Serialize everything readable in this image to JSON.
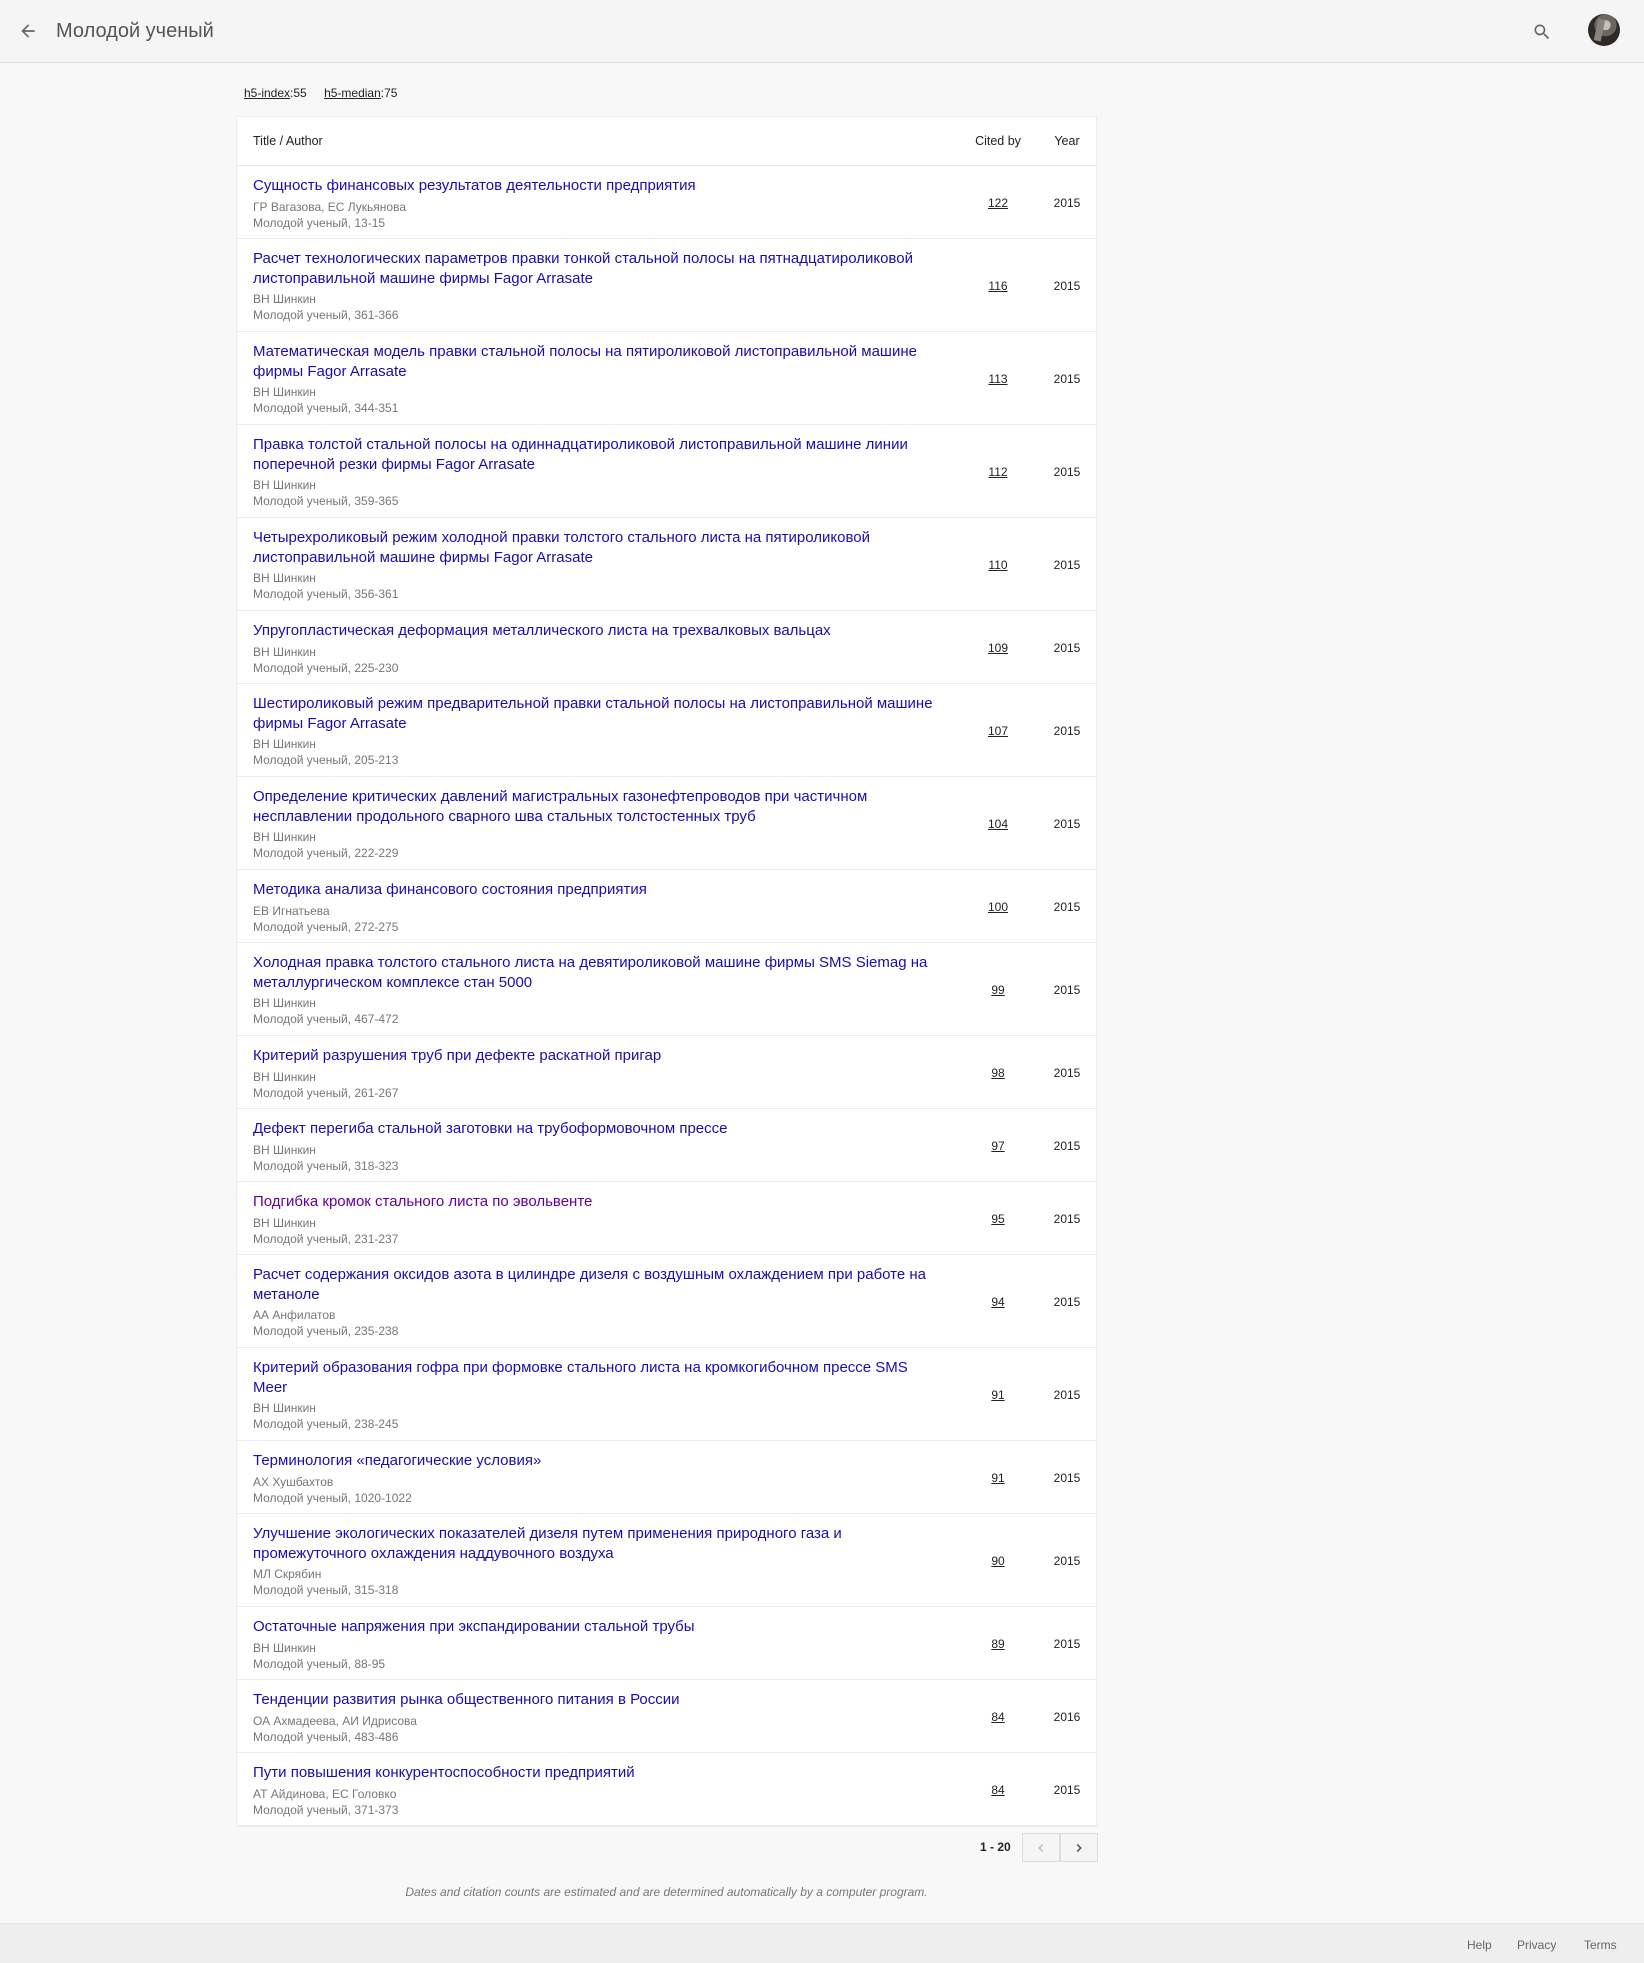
{
  "header": {
    "back_icon": "arrow-back-icon",
    "title": "Молодой ученый",
    "search_icon": "search-icon"
  },
  "metrics": {
    "h5_index_label": "h5-index",
    "h5_index_value": ":55",
    "h5_median_label": "h5-median",
    "h5_median_value": ":75"
  },
  "table": {
    "col_title": "Title / Author",
    "col_cited": "Cited by",
    "col_year": "Year",
    "rows": [
      {
        "title": "Сущность финансовых результатов деятельности предприятия",
        "authors": "ГР Вагазова, ЕС Лукьянова",
        "venue": "Молодой ученый, 13-15",
        "cited": "122",
        "year": "2015"
      },
      {
        "title": "Расчет технологических параметров правки тонкой стальной полосы на пятнадцатироликовой листоправильной машине фирмы Fagor Arrasate",
        "authors": "ВН Шинкин",
        "venue": "Молодой ученый, 361-366",
        "cited": "116",
        "year": "2015"
      },
      {
        "title": "Математическая модель правки стальной полосы на пятироликовой листоправильной машине фирмы Fagor Arrasate",
        "authors": "ВН Шинкин",
        "venue": "Молодой ученый, 344-351",
        "cited": "113",
        "year": "2015"
      },
      {
        "title": "Правка толстой стальной полосы на одиннадцатироликовой листоправильной машине линии поперечной резки фирмы Fagor Arrasate",
        "authors": "ВН Шинкин",
        "venue": "Молодой ученый, 359-365",
        "cited": "112",
        "year": "2015"
      },
      {
        "title": "Четырехроликовый режим холодной правки толстого стального листа на пятироликовой листоправильной машине фирмы Fagor Arrasate",
        "authors": "ВН Шинкин",
        "venue": "Молодой ученый, 356-361",
        "cited": "110",
        "year": "2015"
      },
      {
        "title": "Упругопластическая деформация металлического листа на трехвалковых вальцах",
        "authors": "ВН Шинкин",
        "venue": "Молодой ученый, 225-230",
        "cited": "109",
        "year": "2015"
      },
      {
        "title": "Шестироликовый режим предварительной правки стальной полосы на листоправильной машине фирмы Fagor Arrasate",
        "authors": "ВН Шинкин",
        "venue": "Молодой ученый, 205-213",
        "cited": "107",
        "year": "2015"
      },
      {
        "title": "Определение критических давлений магистральных газонефтепроводов при частичном несплавлении продольного сварного шва стальных толстостенных труб",
        "authors": "ВН Шинкин",
        "venue": "Молодой ученый, 222-229",
        "cited": "104",
        "year": "2015"
      },
      {
        "title": "Методика анализа финансового состояния предприятия",
        "authors": "ЕВ Игнатьева",
        "venue": "Молодой ученый, 272-275",
        "cited": "100",
        "year": "2015"
      },
      {
        "title": "Холодная правка толстого стального листа на девятироликовой машине фирмы SMS Siemag на металлургическом комплексе стан 5000",
        "authors": "ВН Шинкин",
        "venue": "Молодой ученый, 467-472",
        "cited": "99",
        "year": "2015"
      },
      {
        "title": "Критерий разрушения труб при дефекте раскатной пригар",
        "authors": "ВН Шинкин",
        "venue": "Молодой ученый, 261-267",
        "cited": "98",
        "year": "2015"
      },
      {
        "title": "Дефект перегиба стальной заготовки на трубоформовочном прессе",
        "authors": "ВН Шинкин",
        "venue": "Молодой ученый, 318-323",
        "cited": "97",
        "year": "2015"
      },
      {
        "title": "Подгибка кромок стального листа по эвольвенте",
        "authors": "ВН Шинкин",
        "venue": "Молодой ученый, 231-237",
        "cited": "95",
        "year": "2015"
      },
      {
        "title": "Расчет содержания оксидов азота в цилиндре дизеля с воздушным охлаждением при работе на метаноле",
        "authors": "АА Анфилатов",
        "venue": "Молодой ученый, 235-238",
        "cited": "94",
        "year": "2015"
      },
      {
        "title": "Критерий образования гофра при формовке стального листа на кромкогибочном прессе SMS Meer",
        "authors": "ВН Шинкин",
        "venue": "Молодой ученый, 238-245",
        "cited": "91",
        "year": "2015"
      },
      {
        "title": "Терминология «педагогические условия»",
        "authors": "АХ Хушбахтов",
        "venue": "Молодой ученый, 1020-1022",
        "cited": "91",
        "year": "2015"
      },
      {
        "title": "Улучшение экологических показателей дизеля путем применения природного газа и промежуточного охлаждения наддувочного воздуха",
        "authors": "МЛ Скрябин",
        "venue": "Молодой ученый, 315-318",
        "cited": "90",
        "year": "2015"
      },
      {
        "title": "Остаточные напряжения при экспандировании стальной трубы",
        "authors": "ВН Шинкин",
        "venue": "Молодой ученый, 88-95",
        "cited": "89",
        "year": "2015"
      },
      {
        "title": "Тенденции развития рынка общественного питания в России",
        "authors": "ОА Ахмадеева, АИ Идрисова",
        "venue": "Молодой ученый, 483-486",
        "cited": "84",
        "year": "2016"
      },
      {
        "title": "Пути повышения конкурентоспособности предприятий",
        "authors": "АТ Айдинова, ЕС Головко",
        "venue": "Молодой ученый, 371-373",
        "cited": "84",
        "year": "2015"
      }
    ]
  },
  "pagination": {
    "range": "1 - 20",
    "prev_icon": "chevron-left-icon",
    "next_icon": "chevron-right-icon"
  },
  "disclaimer": "Dates and citation counts are estimated and are determined automatically by a computer program.",
  "footer": {
    "help": "Help",
    "privacy": "Privacy",
    "terms": "Terms"
  },
  "colors": {
    "link": "#1a0dab",
    "visited_link": "#660099",
    "meta_text": "#777777",
    "page_bg": "#f8f8f8"
  }
}
